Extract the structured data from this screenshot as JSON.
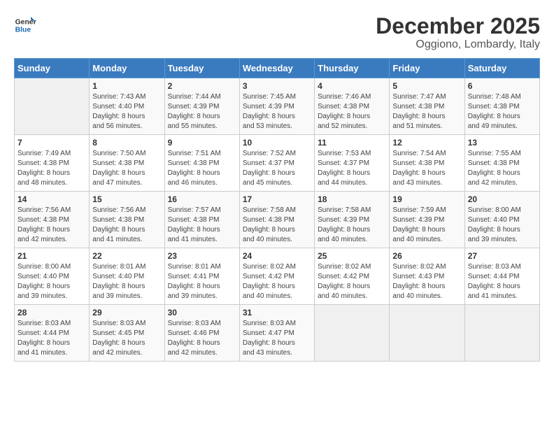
{
  "logo": {
    "line1": "General",
    "line2": "Blue"
  },
  "title": "December 2025",
  "location": "Oggiono, Lombardy, Italy",
  "days_of_week": [
    "Sunday",
    "Monday",
    "Tuesday",
    "Wednesday",
    "Thursday",
    "Friday",
    "Saturday"
  ],
  "weeks": [
    [
      {
        "day": "",
        "info": ""
      },
      {
        "day": "1",
        "info": "Sunrise: 7:43 AM\nSunset: 4:40 PM\nDaylight: 8 hours\nand 56 minutes."
      },
      {
        "day": "2",
        "info": "Sunrise: 7:44 AM\nSunset: 4:39 PM\nDaylight: 8 hours\nand 55 minutes."
      },
      {
        "day": "3",
        "info": "Sunrise: 7:45 AM\nSunset: 4:39 PM\nDaylight: 8 hours\nand 53 minutes."
      },
      {
        "day": "4",
        "info": "Sunrise: 7:46 AM\nSunset: 4:38 PM\nDaylight: 8 hours\nand 52 minutes."
      },
      {
        "day": "5",
        "info": "Sunrise: 7:47 AM\nSunset: 4:38 PM\nDaylight: 8 hours\nand 51 minutes."
      },
      {
        "day": "6",
        "info": "Sunrise: 7:48 AM\nSunset: 4:38 PM\nDaylight: 8 hours\nand 49 minutes."
      }
    ],
    [
      {
        "day": "7",
        "info": "Sunrise: 7:49 AM\nSunset: 4:38 PM\nDaylight: 8 hours\nand 48 minutes."
      },
      {
        "day": "8",
        "info": "Sunrise: 7:50 AM\nSunset: 4:38 PM\nDaylight: 8 hours\nand 47 minutes."
      },
      {
        "day": "9",
        "info": "Sunrise: 7:51 AM\nSunset: 4:38 PM\nDaylight: 8 hours\nand 46 minutes."
      },
      {
        "day": "10",
        "info": "Sunrise: 7:52 AM\nSunset: 4:37 PM\nDaylight: 8 hours\nand 45 minutes."
      },
      {
        "day": "11",
        "info": "Sunrise: 7:53 AM\nSunset: 4:37 PM\nDaylight: 8 hours\nand 44 minutes."
      },
      {
        "day": "12",
        "info": "Sunrise: 7:54 AM\nSunset: 4:38 PM\nDaylight: 8 hours\nand 43 minutes."
      },
      {
        "day": "13",
        "info": "Sunrise: 7:55 AM\nSunset: 4:38 PM\nDaylight: 8 hours\nand 42 minutes."
      }
    ],
    [
      {
        "day": "14",
        "info": "Sunrise: 7:56 AM\nSunset: 4:38 PM\nDaylight: 8 hours\nand 42 minutes."
      },
      {
        "day": "15",
        "info": "Sunrise: 7:56 AM\nSunset: 4:38 PM\nDaylight: 8 hours\nand 41 minutes."
      },
      {
        "day": "16",
        "info": "Sunrise: 7:57 AM\nSunset: 4:38 PM\nDaylight: 8 hours\nand 41 minutes."
      },
      {
        "day": "17",
        "info": "Sunrise: 7:58 AM\nSunset: 4:38 PM\nDaylight: 8 hours\nand 40 minutes."
      },
      {
        "day": "18",
        "info": "Sunrise: 7:58 AM\nSunset: 4:39 PM\nDaylight: 8 hours\nand 40 minutes."
      },
      {
        "day": "19",
        "info": "Sunrise: 7:59 AM\nSunset: 4:39 PM\nDaylight: 8 hours\nand 40 minutes."
      },
      {
        "day": "20",
        "info": "Sunrise: 8:00 AM\nSunset: 4:40 PM\nDaylight: 8 hours\nand 39 minutes."
      }
    ],
    [
      {
        "day": "21",
        "info": "Sunrise: 8:00 AM\nSunset: 4:40 PM\nDaylight: 8 hours\nand 39 minutes."
      },
      {
        "day": "22",
        "info": "Sunrise: 8:01 AM\nSunset: 4:40 PM\nDaylight: 8 hours\nand 39 minutes."
      },
      {
        "day": "23",
        "info": "Sunrise: 8:01 AM\nSunset: 4:41 PM\nDaylight: 8 hours\nand 39 minutes."
      },
      {
        "day": "24",
        "info": "Sunrise: 8:02 AM\nSunset: 4:42 PM\nDaylight: 8 hours\nand 40 minutes."
      },
      {
        "day": "25",
        "info": "Sunrise: 8:02 AM\nSunset: 4:42 PM\nDaylight: 8 hours\nand 40 minutes."
      },
      {
        "day": "26",
        "info": "Sunrise: 8:02 AM\nSunset: 4:43 PM\nDaylight: 8 hours\nand 40 minutes."
      },
      {
        "day": "27",
        "info": "Sunrise: 8:03 AM\nSunset: 4:44 PM\nDaylight: 8 hours\nand 41 minutes."
      }
    ],
    [
      {
        "day": "28",
        "info": "Sunrise: 8:03 AM\nSunset: 4:44 PM\nDaylight: 8 hours\nand 41 minutes."
      },
      {
        "day": "29",
        "info": "Sunrise: 8:03 AM\nSunset: 4:45 PM\nDaylight: 8 hours\nand 42 minutes."
      },
      {
        "day": "30",
        "info": "Sunrise: 8:03 AM\nSunset: 4:46 PM\nDaylight: 8 hours\nand 42 minutes."
      },
      {
        "day": "31",
        "info": "Sunrise: 8:03 AM\nSunset: 4:47 PM\nDaylight: 8 hours\nand 43 minutes."
      },
      {
        "day": "",
        "info": ""
      },
      {
        "day": "",
        "info": ""
      },
      {
        "day": "",
        "info": ""
      }
    ]
  ]
}
